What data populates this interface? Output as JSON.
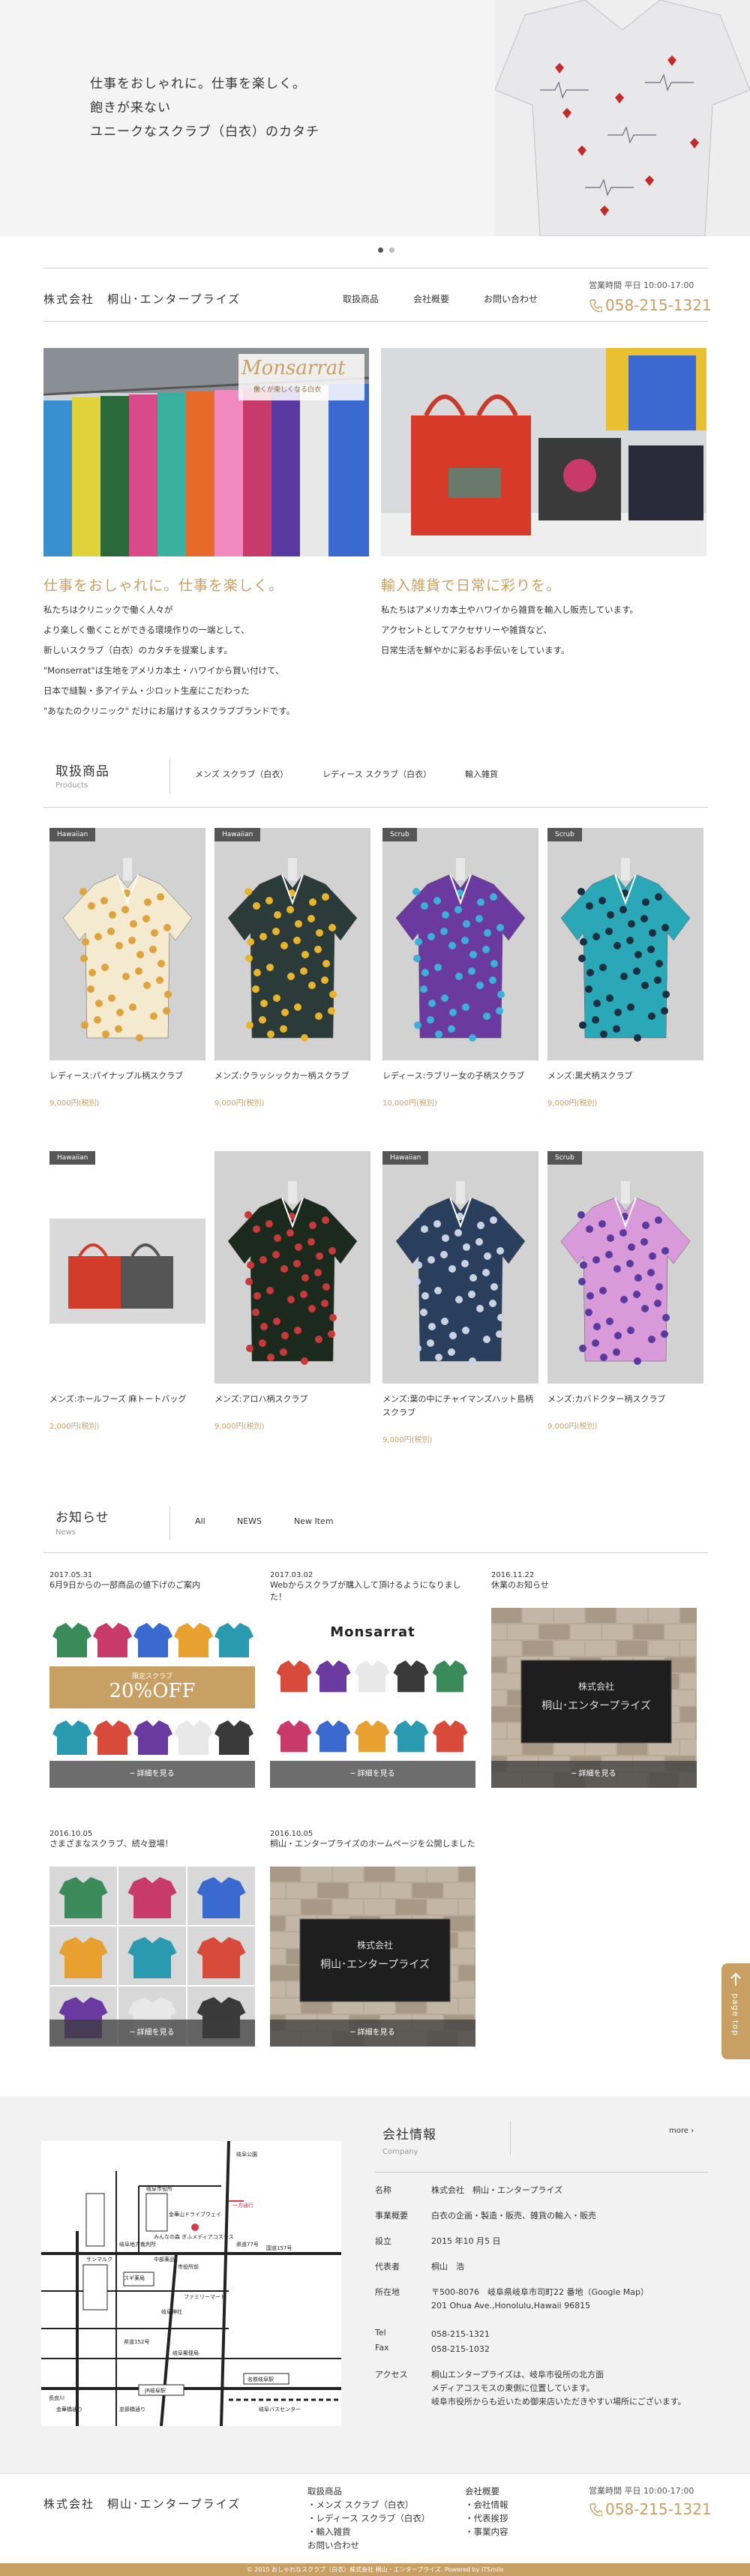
{
  "hero": {
    "line1": "仕事をおしゃれに。仕事を楽しく。",
    "line2": "飽きが来ない",
    "line3": "ユニークなスクラブ（白衣）のカタチ"
  },
  "header": {
    "company": "株式会社　桐山･エンタープライズ",
    "nav": [
      "取扱商品",
      "会社概要",
      "お問い合わせ"
    ],
    "hours": "営業時間 平日 10:00-17:00",
    "phone": "058-215-1321"
  },
  "features": {
    "left": {
      "brand": "Monsarrat",
      "brand_tag": "働くが楽しくなる白衣",
      "title": "仕事をおしゃれに。仕事を楽しく。",
      "lines": [
        "私たちはクリニックで働く人々が",
        "より楽しく働くことができる環境作りの一端として、",
        "新しいスクラブ（白衣）のカタチを提案します。",
        "\"Monserrat\"は生地をアメリカ本土・ハワイから買い付けて、",
        "日本で縫製・多アイテム・少ロット生産にこだわった",
        "\"あなたのクリニック\" だけにお届けするスクラブブランドです。"
      ]
    },
    "right": {
      "title": "輸入雑貨で日常に彩りを。",
      "lines": [
        "私たちはアメリカ本土やハワイから雑貨を輸入し販売しています。",
        "アクセントとしてアクセサリーや雑貨など、",
        "日常生活を鮮やかに彩るお手伝いをしています。"
      ]
    }
  },
  "products": {
    "title": "取扱商品",
    "subtitle": "Products",
    "tabs": [
      "メンズ スクラブ（白衣）",
      "レディース スクラブ（白衣）",
      "輸入雑貨"
    ],
    "items": [
      {
        "badge": "Hawaiian",
        "name": "レディース:パイナップル柄スクラブ",
        "price": "9,000円(税別)",
        "color": "#f3ead0",
        "accent": "#e0a23a"
      },
      {
        "badge": "Hawaiian",
        "name": "メンズ:クラッシックカー柄スクラブ",
        "price": "9,000円(税別)",
        "color": "#2b3b3a",
        "accent": "#e8b42c"
      },
      {
        "badge": "Scrub",
        "name": "レディース:ラブリー女の子柄スクラブ",
        "price": "10,000円(税別)",
        "color": "#6a3aa0",
        "accent": "#3cb0d8"
      },
      {
        "badge": "Scrub",
        "name": "メンズ:黒犬柄スクラブ",
        "price": "9,000円(税別)",
        "color": "#2aa8b8",
        "accent": "#1a3040"
      },
      {
        "badge": "Hawaiian",
        "name": "メンズ:ホールフーズ 麻トートバッグ",
        "price": "2,000円(税別)",
        "color": "#d23a2a",
        "accent": "#555555"
      },
      {
        "badge": "",
        "name": "メンズ:アロハ柄スクラブ",
        "price": "9,000円(税別)",
        "color": "#1c2a1e",
        "accent": "#c83a3a"
      },
      {
        "badge": "Hawaiian",
        "name": "メンズ:葉の中にチャイマンズハット島柄スクラブ",
        "price": "9,000円(税別)",
        "color": "#2a3e5e",
        "accent": "#c8d2e0"
      },
      {
        "badge": "Scrub",
        "name": "メンズ:カバドクター柄スクラブ",
        "price": "9,000円(税別)",
        "color": "#d89ad8",
        "accent": "#5a3aa0"
      }
    ]
  },
  "news": {
    "title": "お知らせ",
    "subtitle": "News",
    "tabs": [
      "All",
      "NEWS",
      "New Item"
    ],
    "more": "─ 詳細を見る",
    "items": [
      {
        "date": "2017.05.31",
        "title": "6月9日からの一部商品の値下げのご案内",
        "kind": "sale",
        "sale_label": "限定スクラブ",
        "sale_value": "20%OFF"
      },
      {
        "date": "2017.03.02",
        "title": "Webからスクラブが購入して頂けるようになりました！",
        "kind": "lineup",
        "brand": "Monsarrat"
      },
      {
        "date": "2016.11.22",
        "title": "休業のお知らせ",
        "kind": "sign",
        "sign1": "株式会社",
        "sign2": "桐山･エンタープライズ"
      },
      {
        "date": "2016.10.05",
        "title": "さまざまなスクラブ、続々登場！",
        "kind": "grid"
      },
      {
        "date": "2016.10.05",
        "title": "桐山・エンタープライズのホームページを公開しました",
        "kind": "sign",
        "sign1": "株式会社",
        "sign2": "桐山･エンタープライズ"
      }
    ]
  },
  "sidetab": {
    "label": "page top"
  },
  "map": {
    "labels": [
      "岐阜市役所",
      "金華山ドライブウェイ",
      "みんなの森 ぎふメディアコスモス",
      "岐阜公園",
      "一方通行",
      "岐阜地方裁判所",
      "中部薬品",
      "スギ薬局",
      "岐阜神社",
      "県道77号",
      "県道152号",
      "市役所前",
      "国道157号",
      "ファミリーマート",
      "岐阜郵便局",
      "JR岐阜駅",
      "名鉄岐阜駅",
      "長良川",
      "金華橋通り",
      "忠節橋通り",
      "岐阜バスセンター",
      "サンマルク"
    ]
  },
  "company": {
    "title": "会社情報",
    "subtitle": "Company",
    "more": "more ›",
    "rows": [
      {
        "label": "名称",
        "value": "株式会社　桐山・エンタープライズ"
      },
      {
        "label": "事業概要",
        "value": "白衣の企画・製造・販売、雑貨の輸入・販売"
      },
      {
        "label": "設立",
        "value": "2015 年10 月5 日"
      },
      {
        "label": "代表者",
        "value": "桐山　浩"
      },
      {
        "label": "所在地",
        "value": "〒500-8076　岐阜県岐阜市司町22 番地（Google Map）",
        "value2": "201 Ohua Ave.,Honolulu,Hawaii 96815"
      },
      {
        "label": "Tel",
        "value": "058-215-1321"
      },
      {
        "label": "Fax",
        "value": "058-215-1032"
      },
      {
        "label": "アクセス",
        "value": "桐山エンタープライズは、岐阜市役所の北方面",
        "value2": "メディアコスモスの東側に位置しています。",
        "value3": "岐阜市役所からも近いため御来店いただきやすい場所にございます。"
      }
    ]
  },
  "footer": {
    "company": "株式会社　桐山･エンタープライズ",
    "col1": [
      "取扱商品",
      "・メンズ スクラブ（白衣）",
      "・レディース スクラブ（白衣）",
      "・輸入雑貨",
      "お問い合わせ"
    ],
    "col2": [
      "会社概要",
      "・会社情報",
      "・代表挨拶",
      "・事業内容"
    ],
    "hours": "営業時間 平日 10:00-17:00",
    "phone": "058-215-1321",
    "copyright": "© 2015 おしゃれなスクラブ（白衣）株式会社 桐山・エンタープライズ. Powered by ITSmile"
  }
}
